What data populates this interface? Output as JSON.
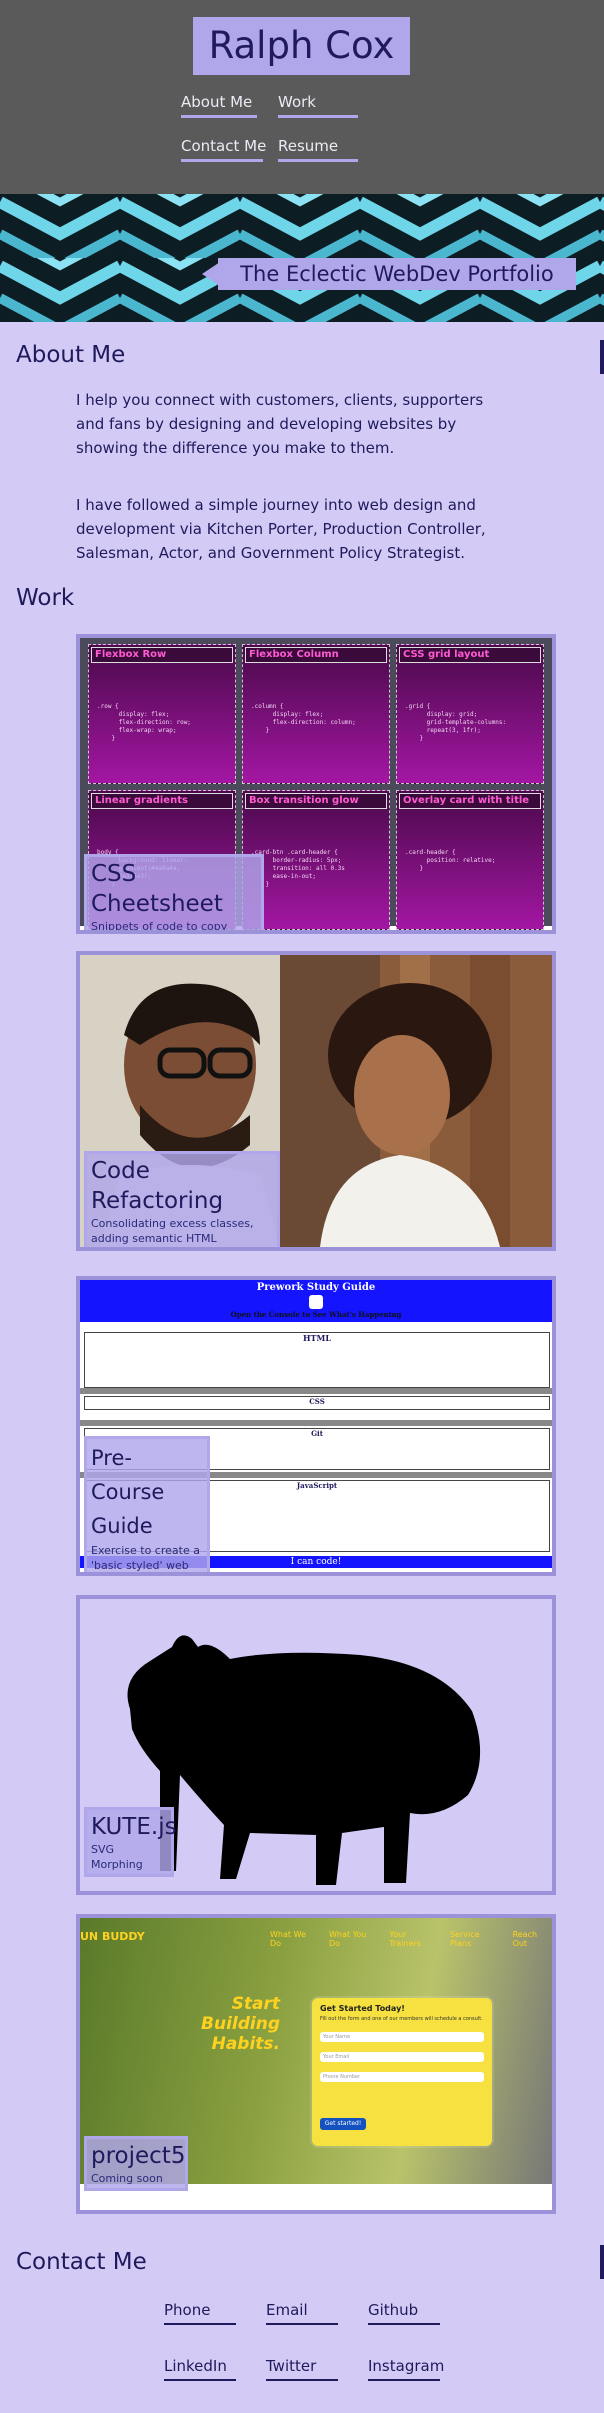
{
  "header": {
    "name": "Ralph Cox",
    "nav": [
      {
        "label": "About Me"
      },
      {
        "label": "Work"
      },
      {
        "label": "Contact Me"
      },
      {
        "label": "Resume"
      }
    ]
  },
  "hero": {
    "title": "The Eclectic WebDev Portfolio"
  },
  "about": {
    "heading": "About Me",
    "paragraphs": [
      "I help you connect with customers, clients, supporters and fans by designing and developing websites by showing the difference you make to them.",
      "I have followed a simple journey into web design and development via Kitchen Porter, Production Controller, Salesman, Actor, and Government Policy Strategist."
    ]
  },
  "work": {
    "heading": "Work",
    "projects": [
      {
        "title": "CSS Cheetsheet",
        "subtitle": "Snippets of code to copy"
      },
      {
        "title": "Code Refactoring",
        "subtitle": "Consolidating excess classes, adding semantic HTML"
      },
      {
        "title": "Pre-Course Guide",
        "subtitle": "Exercise to create a 'basic styled' web page in Repo"
      },
      {
        "title": "KUTE.js",
        "subtitle": "SVG Morphing"
      },
      {
        "title": "project5",
        "subtitle": "Coming soon"
      }
    ],
    "css_tiles": [
      "Flexbox Row",
      "Flexbox Column",
      "CSS grid layout",
      "Linear gradients",
      "Box transition glow",
      "Overlay card with title"
    ],
    "prework": {
      "title": "Prework Study Guide",
      "console": "Open the Console to See What's Happening",
      "sections": [
        "HTML",
        "CSS",
        "Git",
        "JavaScript"
      ],
      "button": "I can code!"
    },
    "fitness": {
      "brand": "UN BUDDY",
      "nav": [
        "What We Do",
        "What You Do",
        "Your Trainers",
        "Service Plans",
        "Reach Out"
      ],
      "headline1": "Start Building",
      "headline2": "Habits.",
      "form_title": "Get Started Today!",
      "form_sub": "Fill out the form and one of our members will schedule a consult.",
      "fields": [
        "Your Name",
        "Your Email",
        "Phone Number"
      ],
      "submit": "Get started!"
    }
  },
  "contact": {
    "heading": "Contact Me",
    "links": [
      {
        "label": "Phone"
      },
      {
        "label": "Email"
      },
      {
        "label": "Github"
      },
      {
        "label": "LinkedIn"
      },
      {
        "label": "Twitter"
      },
      {
        "label": "Instagram"
      }
    ]
  },
  "colors": {
    "background": "#d3cbf5",
    "accent": "#b0a6ea",
    "header": "#5a5a5a",
    "text": "#1f1a5c"
  }
}
